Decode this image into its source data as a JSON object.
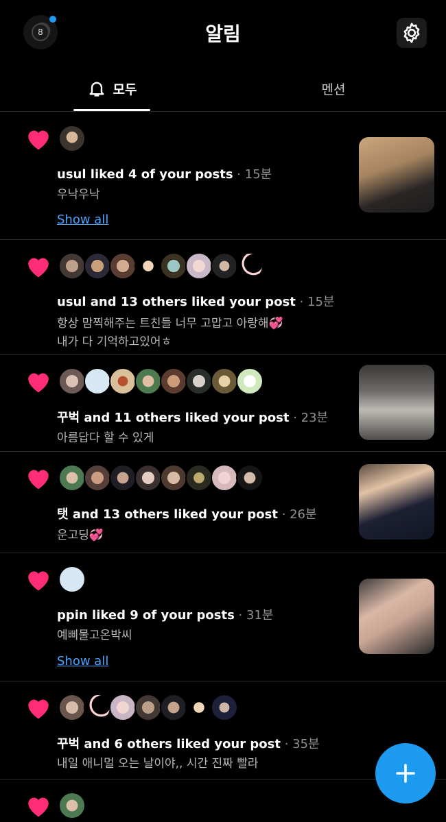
{
  "header": {
    "title": "알림",
    "profile_badge": "8"
  },
  "tabs": {
    "all": "모두",
    "mentions": "멘션"
  },
  "colors": {
    "heart": "#ff2d78",
    "accent": "#1d9bf0",
    "link": "#4aa3ff"
  },
  "notifications": [
    {
      "name": "usul",
      "action": " liked 4 of your posts",
      "time": " · 15분",
      "text1": "우낙우낙",
      "text2": "",
      "show_all": "Show all"
    },
    {
      "name": "usul",
      "action": " and 13 others liked your post",
      "time": " · 15분",
      "text1": "항상 맘찍해주는 트친들 너무 고맙고 아랑해💞",
      "text2": "내가 다 기억하고있어ㅎ",
      "show_all": ""
    },
    {
      "name": "꾸벅",
      "action": " and 11 others liked your post",
      "time": " · 23분",
      "text1": "아름답다 할 수 있게",
      "text2": "",
      "show_all": ""
    },
    {
      "name": "탯",
      "action": " and 13 others liked your post",
      "time": " · 26분",
      "text1": "운고딩💞",
      "text2": "",
      "show_all": ""
    },
    {
      "name": "ppin",
      "action": " liked 9 of your posts",
      "time": " · 31분",
      "text1": "예삐물고온박씨",
      "text2": "",
      "show_all": "Show all"
    },
    {
      "name": "꾸벅",
      "action": " and 6 others liked your post",
      "time": " · 35분",
      "text1": "내일 애니멀 오는 날이야,, 시간 진짜 빨라",
      "text2": "",
      "show_all": ""
    }
  ]
}
